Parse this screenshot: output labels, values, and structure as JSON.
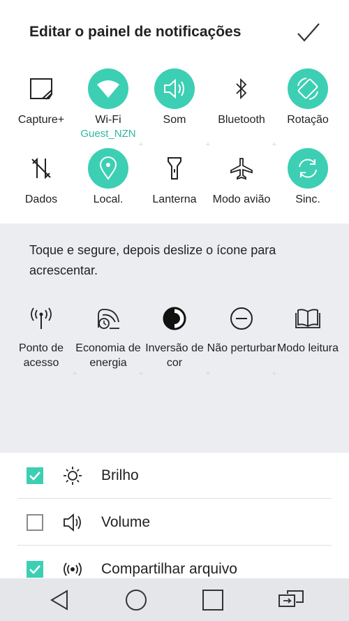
{
  "header": {
    "title": "Editar o painel de notificações",
    "confirm_icon": "check-icon"
  },
  "active_tiles": [
    {
      "label": "Capture+",
      "icon": "capture-plus-icon",
      "on": false
    },
    {
      "label": "Wi-Fi",
      "sub": "Guest_NZN",
      "icon": "wifi-icon",
      "on": true
    },
    {
      "label": "Som",
      "icon": "sound-icon",
      "on": true
    },
    {
      "label": "Bluetooth",
      "icon": "bluetooth-icon",
      "on": false
    },
    {
      "label": "Rotação",
      "icon": "rotation-icon",
      "on": true
    },
    {
      "label": "Dados",
      "icon": "data-icon",
      "on": false
    },
    {
      "label": "Local.",
      "icon": "location-icon",
      "on": true
    },
    {
      "label": "Lanterna",
      "icon": "flashlight-icon",
      "on": false
    },
    {
      "label": "Modo avião",
      "icon": "airplane-icon",
      "on": false
    },
    {
      "label": "Sinc.",
      "icon": "sync-icon",
      "on": true
    }
  ],
  "available": {
    "instruction": "Toque e segure, depois deslize o ícone para acrescentar.",
    "tiles": [
      {
        "label": "Ponto de acesso",
        "icon": "hotspot-icon"
      },
      {
        "label": "Economia de energia",
        "icon": "power-saving-icon"
      },
      {
        "label": "Inversão de cor",
        "icon": "color-inversion-icon"
      },
      {
        "label": "Não perturbar",
        "icon": "do-not-disturb-icon"
      },
      {
        "label": "Modo leitura",
        "icon": "reading-mode-icon"
      }
    ]
  },
  "settings": [
    {
      "label": "Brilho",
      "checked": true,
      "icon": "brightness-icon"
    },
    {
      "label": "Volume",
      "checked": false,
      "icon": "volume-icon"
    },
    {
      "label": "Compartilhar arquivo",
      "checked": true,
      "icon": "file-share-icon"
    }
  ],
  "navbar": {
    "icons": [
      "back-icon",
      "home-icon",
      "recents-icon",
      "dual-window-icon"
    ]
  },
  "colors": {
    "accent": "#3ccfb3",
    "sub_text": "#2fb8a1",
    "available_bg": "#ebedf0",
    "navbar_bg": "#e4e6ea"
  }
}
